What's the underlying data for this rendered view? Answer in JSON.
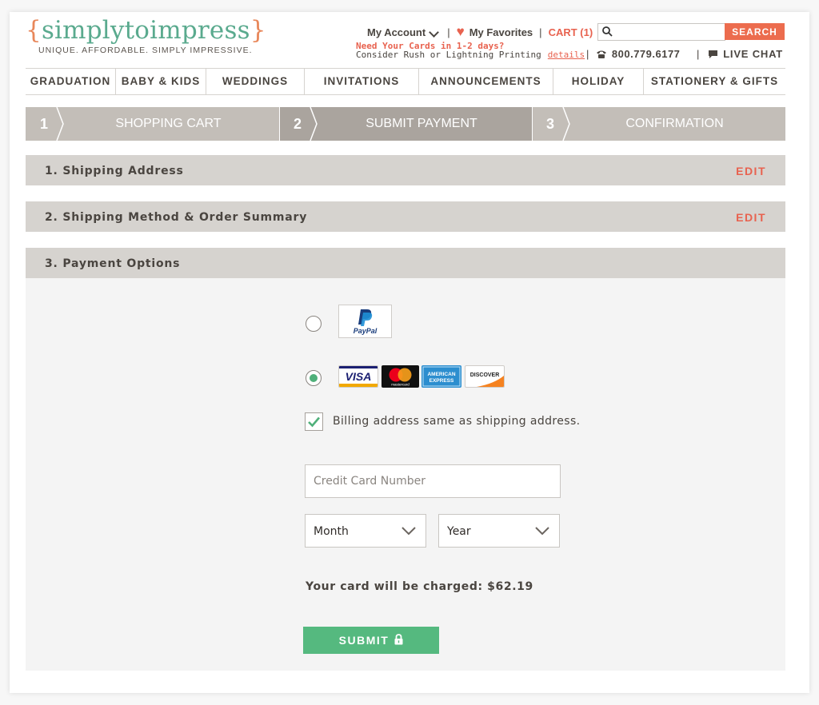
{
  "brand": {
    "logo_text": "simplytoimpress",
    "tagline": "UNIQUE. AFFORDABLE. SIMPLY IMPRESSIVE.",
    "colors": {
      "green": "#5aaa8e",
      "orange": "#e8875a",
      "accent_red": "#e8624f",
      "submit_green": "#55b97f"
    }
  },
  "header": {
    "my_account": "My Account",
    "my_favorites": "My Favorites",
    "cart": "CART (1)",
    "separator": "|",
    "search_placeholder": "",
    "search_button": "SEARCH",
    "rush_headline": "Need Your Cards in 1-2 days?",
    "rush_sub": "Consider Rush or Lightning Printing",
    "rush_link": "details",
    "phone": "800.779.6177",
    "live_chat": "LIVE CHAT"
  },
  "nav": {
    "items": [
      {
        "label": "GRADUATION"
      },
      {
        "label": "BABY & KIDS"
      },
      {
        "label": "WEDDINGS"
      },
      {
        "label": "INVITATIONS"
      },
      {
        "label": "ANNOUNCEMENTS"
      },
      {
        "label": "HOLIDAY"
      },
      {
        "label": "STATIONERY & GIFTS"
      }
    ]
  },
  "steps": [
    {
      "number": "1",
      "label": "SHOPPING CART",
      "active": false
    },
    {
      "number": "2",
      "label": "SUBMIT PAYMENT",
      "active": true
    },
    {
      "number": "3",
      "label": "CONFIRMATION",
      "active": false
    }
  ],
  "sections": {
    "shipping_address": {
      "title": "1. Shipping Address",
      "edit": "EDIT"
    },
    "shipping_method": {
      "title": "2. Shipping Method & Order Summary",
      "edit": "EDIT"
    },
    "payment_options": {
      "title": "3. Payment Options"
    }
  },
  "payment": {
    "paypal": {
      "selected": false,
      "logo_text": "PayPal"
    },
    "credit_card": {
      "selected": true,
      "cards": [
        {
          "name": "VISA",
          "text": "VISA"
        },
        {
          "name": "Mastercard",
          "text": "mastercard"
        },
        {
          "name": "American Express",
          "text_top": "AMERICAN",
          "text_bottom": "EXPRESS"
        },
        {
          "name": "Discover",
          "text": "DISCOVER"
        }
      ]
    },
    "billing_same": {
      "checked": true,
      "label": "Billing address same as shipping address."
    },
    "card_number_placeholder": "Credit Card Number",
    "month_select": "Month",
    "year_select": "Year",
    "charge_text": "Your card will be charged: $62.19",
    "submit_label": "SUBMIT"
  }
}
